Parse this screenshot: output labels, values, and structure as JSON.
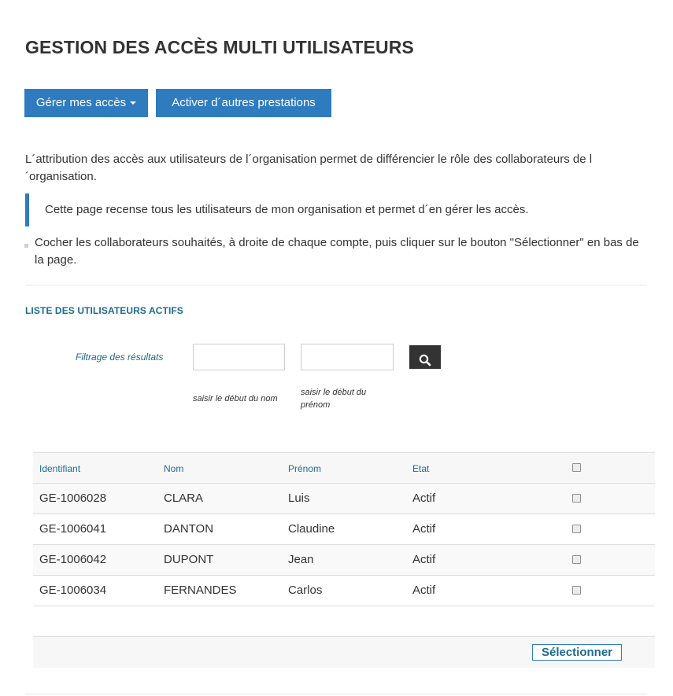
{
  "page": {
    "title": "GESTION DES ACCÈS MULTI UTILISATEURS"
  },
  "toolbar": {
    "manage_label": "Gérer mes accès",
    "activate_label": "Activer d´autres prestations"
  },
  "intro": {
    "paragraph": "L´attribution des accès aux utilisateurs de l´organisation permet de différencier le rôle des collaborateurs de l´organisation.",
    "quote": "Cette page recense tous les utilisateurs de mon organisation et permet d´en gérer les accès.",
    "instruction": "Cocher les collaborateurs souhaités, à droite de chaque compte, puis cliquer sur le bouton \"Sélectionner\" en bas de la page."
  },
  "section": {
    "title": "LISTE DES UTILISATEURS ACTIFS"
  },
  "filter": {
    "label": "Filtrage des résultats",
    "name_value": "",
    "firstname_value": "",
    "name_hint": "saisir le début du nom",
    "firstname_hint": "saisir le début du prénom",
    "search_icon": "search-icon"
  },
  "table": {
    "headers": {
      "id": "Identifiant",
      "nom": "Nom",
      "prenom": "Prénom",
      "etat": "Etat"
    },
    "rows": [
      {
        "id": "GE-1006028",
        "nom": "CLARA",
        "prenom": "Luis",
        "etat": "Actif",
        "checked": false
      },
      {
        "id": "GE-1006041",
        "nom": "DANTON",
        "prenom": "Claudine",
        "etat": "Actif",
        "checked": false
      },
      {
        "id": "GE-1006042",
        "nom": "DUPONT",
        "prenom": "Jean",
        "etat": "Actif",
        "checked": false
      },
      {
        "id": "GE-1006034",
        "nom": "FERNANDES",
        "prenom": "Carlos",
        "etat": "Actif",
        "checked": false
      }
    ]
  },
  "footer": {
    "select_label": "Sélectionner"
  },
  "colors": {
    "primary": "#2e7bbf",
    "link_text": "#1e6a8d",
    "body_text": "#333333",
    "search_button": "#333333"
  }
}
